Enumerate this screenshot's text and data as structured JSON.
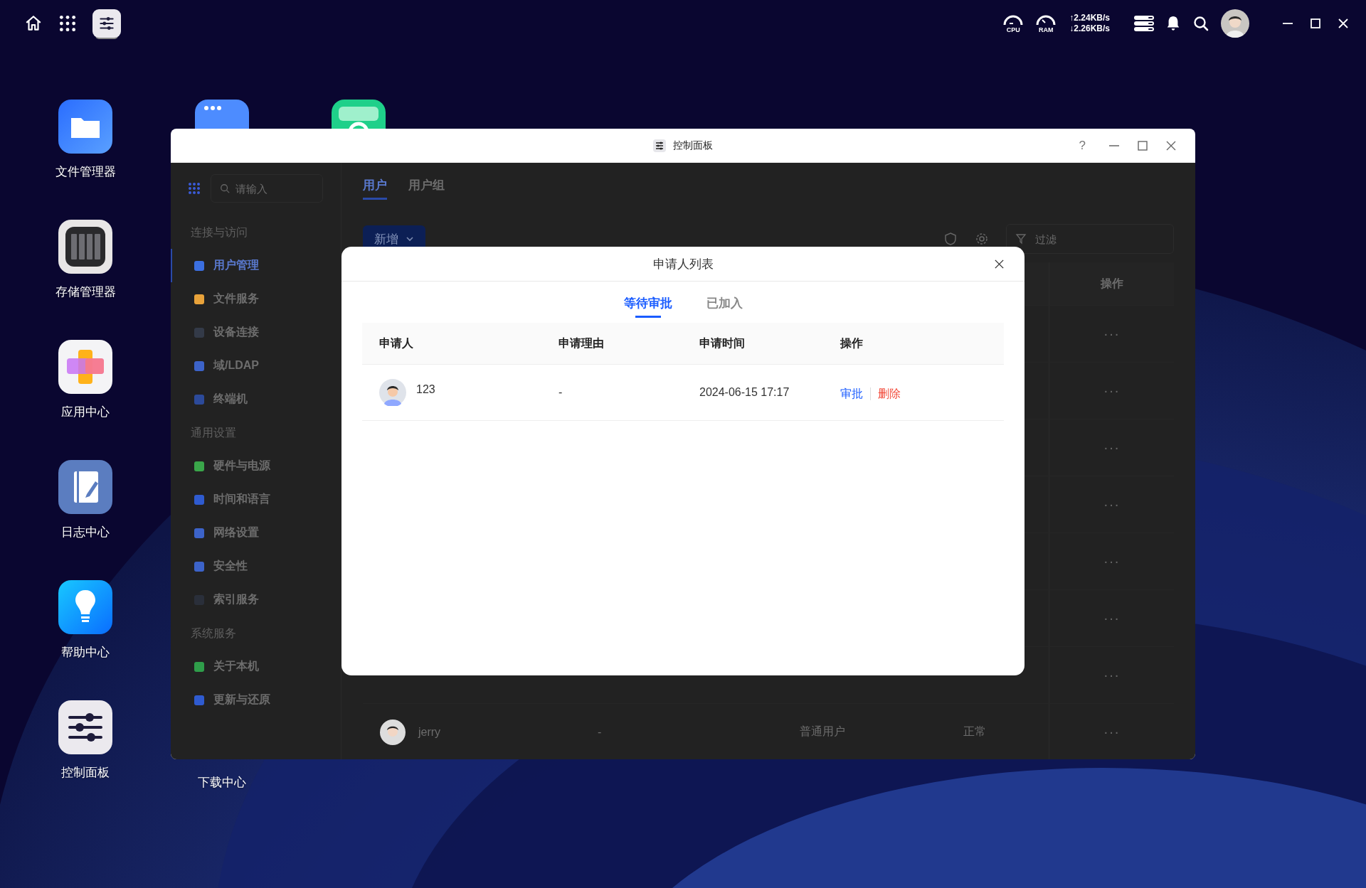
{
  "top_bar": {
    "cpu_label": "CPU",
    "ram_label": "RAM",
    "upload": "↑2.24KB/s",
    "download": "↓2.26KB/s"
  },
  "desktop": {
    "column_1": [
      {
        "kind": "folder",
        "label": "文件管理器"
      },
      {
        "kind": "storage",
        "label": "存储管理器"
      },
      {
        "kind": "apps",
        "label": "应用中心"
      },
      {
        "kind": "log",
        "label": "日志中心"
      },
      {
        "kind": "help",
        "label": "帮助中心"
      },
      {
        "kind": "settings",
        "label": "控制面板"
      }
    ],
    "column_2": [
      {
        "kind": "browser"
      },
      {
        "label": "下载中心"
      }
    ],
    "column_3": [
      {
        "kind": "sync"
      }
    ]
  },
  "window": {
    "title": "控制面板",
    "help": "?"
  },
  "sidebar": {
    "search_placeholder": "请输入",
    "sections": [
      {
        "title": "连接与访问",
        "items": [
          {
            "label": "用户管理",
            "kind": "user",
            "selected": true
          },
          {
            "label": "文件服务",
            "kind": "folder",
            "selected": false
          },
          {
            "label": "设备连接",
            "kind": "device",
            "selected": false
          },
          {
            "label": "域/LDAP",
            "kind": "domain",
            "selected": false
          },
          {
            "label": "终端机",
            "kind": "terminal",
            "selected": false
          }
        ]
      },
      {
        "title": "通用设置",
        "items": [
          {
            "label": "硬件与电源",
            "kind": "power",
            "selected": false
          },
          {
            "label": "时间和语言",
            "kind": "globe",
            "selected": false
          },
          {
            "label": "网络设置",
            "kind": "network",
            "selected": false
          },
          {
            "label": "安全性",
            "kind": "shield",
            "selected": false
          },
          {
            "label": "索引服务",
            "kind": "index",
            "selected": false
          }
        ]
      },
      {
        "title": "系统服务",
        "items": [
          {
            "label": "关于本机",
            "kind": "info",
            "selected": false
          },
          {
            "label": "更新与还原",
            "kind": "update",
            "selected": false
          }
        ]
      }
    ]
  },
  "main": {
    "tabs": [
      {
        "label": "用户",
        "selected": true
      },
      {
        "label": "用户组",
        "selected": false
      }
    ],
    "add_button": "新增",
    "filter_placeholder": "过滤",
    "table": {
      "action_header": "操作",
      "rows": [
        {
          "more": "···"
        },
        {
          "more": "···"
        },
        {
          "more": "···"
        },
        {
          "more": "···"
        },
        {
          "more": "···"
        },
        {
          "more": "···"
        },
        {
          "more": "···"
        },
        {
          "name": "jerry",
          "column_2": "-",
          "role": "普通用户",
          "status": "正常",
          "more": "···"
        }
      ]
    }
  },
  "modal": {
    "title": "申请人列表",
    "tabs": [
      {
        "label": "等待审批",
        "selected": true
      },
      {
        "label": "已加入",
        "selected": false
      }
    ],
    "columns": [
      "申请人",
      "申请理由",
      "申请时间",
      "操作"
    ],
    "rows": [
      {
        "name": "123",
        "reason": "-",
        "time": "2024-06-15 17:17",
        "actions": [
          {
            "label": "审批",
            "kind": "approve"
          },
          {
            "label": "删除",
            "kind": "delete"
          }
        ]
      }
    ]
  }
}
